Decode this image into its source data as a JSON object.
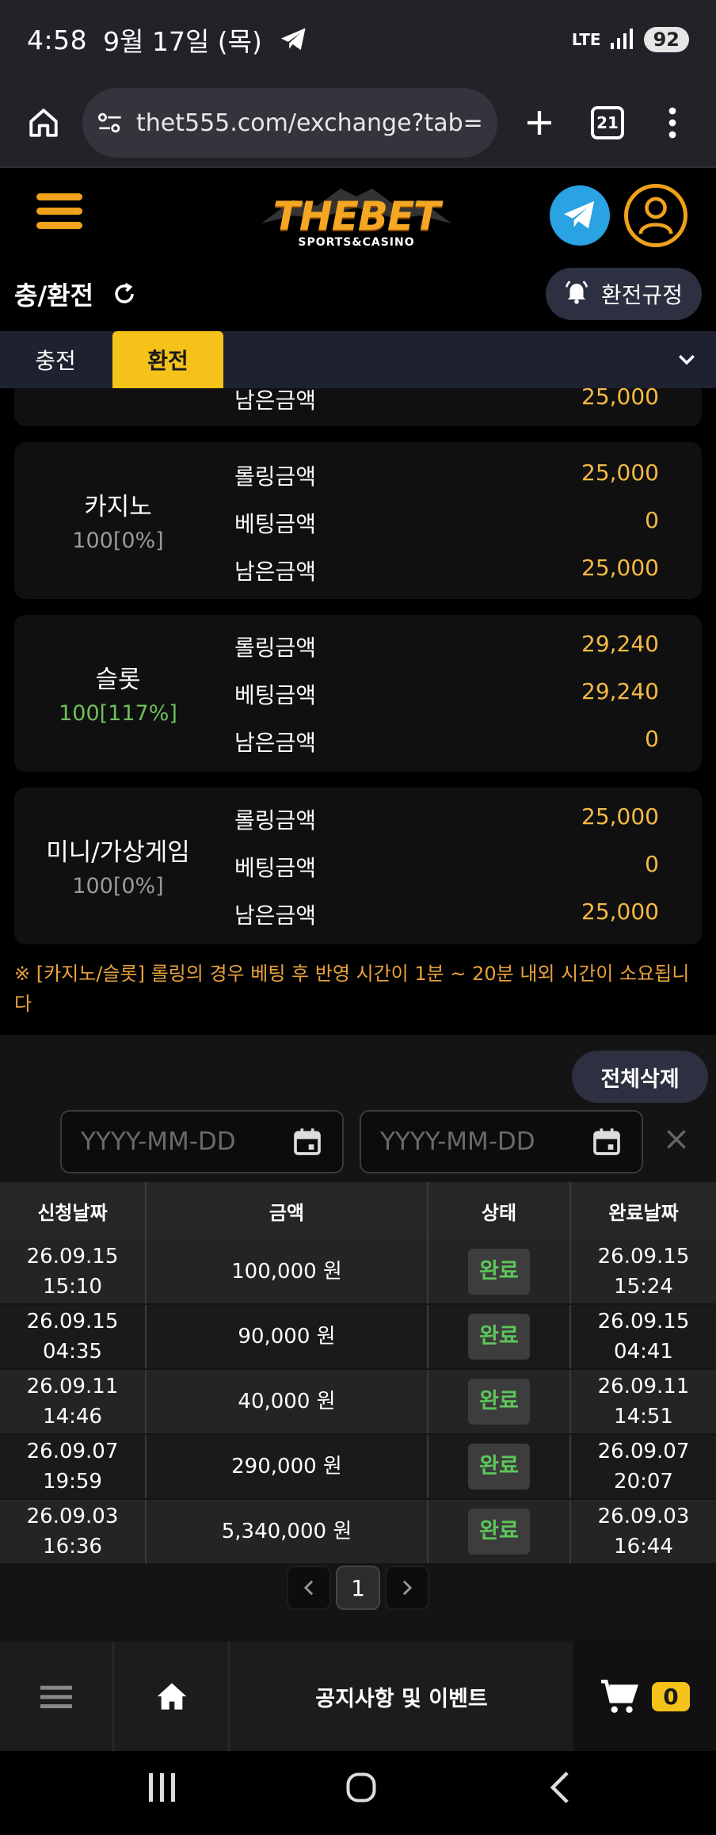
{
  "statusbar": {
    "time": "4:58",
    "date": "9월 17일 (목)",
    "network": "LTE",
    "battery": "92"
  },
  "browser": {
    "url": "thet555.com/exchange?tab=",
    "tab_count": "21"
  },
  "site": {
    "brand": "THEBET",
    "brand_sub": "SPORTS&CASINO"
  },
  "page": {
    "title": "충/환전",
    "rules_button": "환전규정"
  },
  "tabs": {
    "deposit": "충전",
    "withdraw": "환전",
    "active": "환전"
  },
  "partial_card": {
    "label": "남은금액",
    "value": "25,000"
  },
  "rolling_cards": [
    {
      "name": "카지노",
      "percent": "100[0%]",
      "percent_color": "#9a9a9a",
      "rows": [
        {
          "label": "롤링금액",
          "value": "25,000"
        },
        {
          "label": "베팅금액",
          "value": "0"
        },
        {
          "label": "남은금액",
          "value": "25,000"
        }
      ]
    },
    {
      "name": "슬롯",
      "percent": "100[117%]",
      "percent_color": "#6fbf5a",
      "rows": [
        {
          "label": "롤링금액",
          "value": "29,240"
        },
        {
          "label": "베팅금액",
          "value": "29,240"
        },
        {
          "label": "남은금액",
          "value": "0"
        }
      ]
    },
    {
      "name": "미니/가상게임",
      "percent": "100[0%]",
      "percent_color": "#9a9a9a",
      "rows": [
        {
          "label": "롤링금액",
          "value": "25,000"
        },
        {
          "label": "베팅금액",
          "value": "0"
        },
        {
          "label": "남은금액",
          "value": "25,000"
        }
      ]
    }
  ],
  "notice": "※ [카지노/슬롯] 롤링의 경우 베팅 후 반영 시간이 1분 ~ 20분 내외 시간이 소요됩니다",
  "history": {
    "delete_all": "전체삭제",
    "date_from_placeholder": "YYYY-MM-DD",
    "date_to_placeholder": "YYYY-MM-DD",
    "columns": [
      "신청날짜",
      "금액",
      "상태",
      "완료날짜"
    ],
    "rows": [
      {
        "req_date": "26.09.15",
        "req_time": "15:10",
        "amount": "100,000 원",
        "status": "완료",
        "done_date": "26.09.15",
        "done_time": "15:24"
      },
      {
        "req_date": "26.09.15",
        "req_time": "04:35",
        "amount": "90,000 원",
        "status": "완료",
        "done_date": "26.09.15",
        "done_time": "04:41"
      },
      {
        "req_date": "26.09.11",
        "req_time": "14:46",
        "amount": "40,000 원",
        "status": "완료",
        "done_date": "26.09.11",
        "done_time": "14:51"
      },
      {
        "req_date": "26.09.07",
        "req_time": "19:59",
        "amount": "290,000 원",
        "status": "완료",
        "done_date": "26.09.07",
        "done_time": "20:07"
      },
      {
        "req_date": "26.09.03",
        "req_time": "16:36",
        "amount": "5,340,000 원",
        "status": "완료",
        "done_date": "26.09.03",
        "done_time": "16:44"
      }
    ],
    "page": "1"
  },
  "bottom_nav": {
    "notice_label": "공지사항 및 이벤트",
    "cart_count": "0"
  },
  "colors": {
    "accent": "#f5c21a",
    "value_orange": "#f5b945",
    "status_green": "#5dc65a",
    "telegram": "#2aa3e3"
  },
  "icons": [
    "telegram-icon",
    "home-icon",
    "tune-icon",
    "plus-icon",
    "more-icon",
    "menu-icon",
    "user-icon",
    "refresh-icon",
    "bell-icon",
    "chevron-down-icon",
    "calendar-icon",
    "close-icon",
    "cart-icon"
  ]
}
